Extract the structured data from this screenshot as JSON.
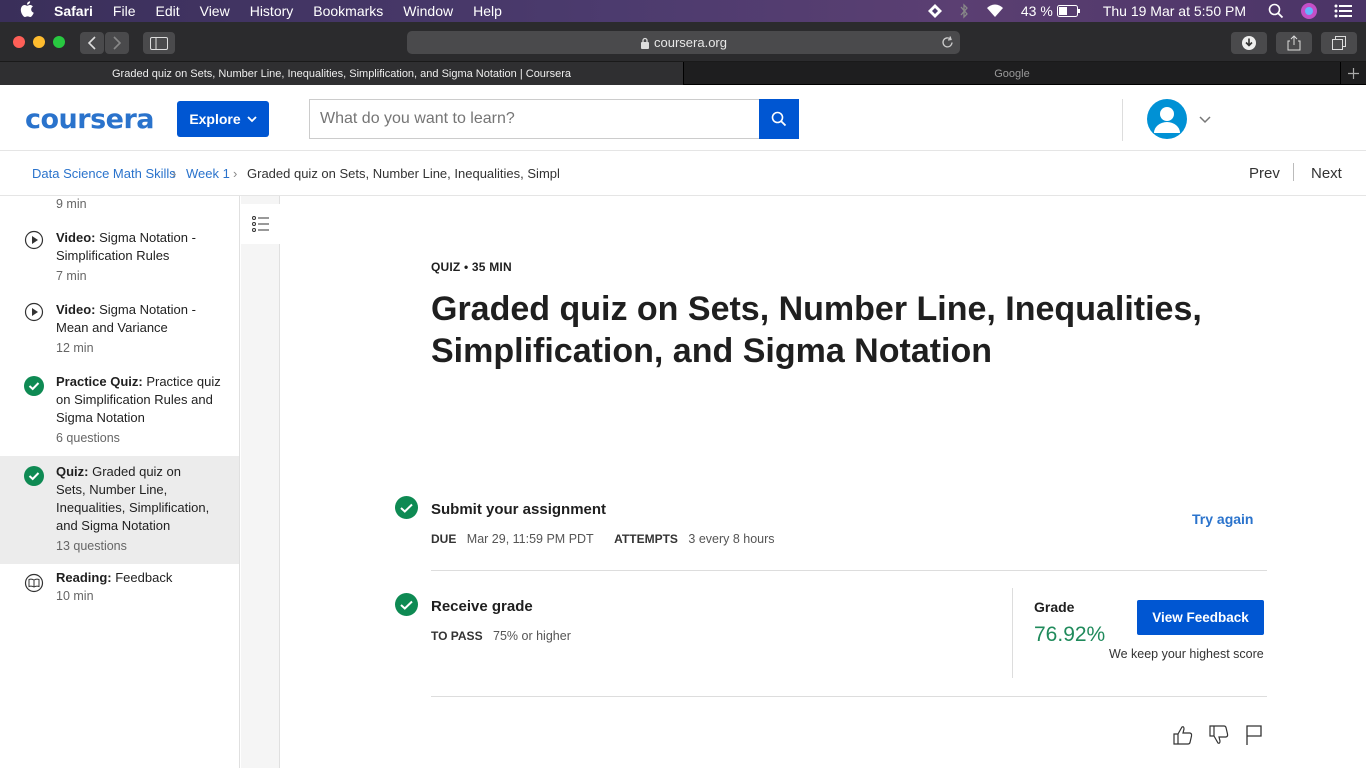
{
  "menubar": {
    "app": "Safari",
    "items": [
      "File",
      "Edit",
      "View",
      "History",
      "Bookmarks",
      "Window",
      "Help"
    ],
    "battery": "43 %",
    "datetime": "Thu 19 Mar at  5:50 PM"
  },
  "browser": {
    "url": "coursera.org",
    "tabs": [
      {
        "label": "Graded quiz on Sets, Number Line, Inequalities, Simplification, and Sigma Notation | Coursera",
        "active": true
      },
      {
        "label": "Google",
        "active": false
      }
    ]
  },
  "header": {
    "logo": "coursera",
    "explore_label": "Explore",
    "search_placeholder": "What do you want to learn?"
  },
  "breadcrumb": {
    "items": [
      "Data Science Math Skills",
      "Week 1",
      "Graded quiz on Sets, Number Line, Inequalities, Simpl"
    ],
    "prev": "Prev",
    "next": "Next"
  },
  "sidebar": {
    "items": [
      {
        "type": "",
        "title": "",
        "meta": "9 min",
        "icon": "none"
      },
      {
        "type": "Video:",
        "title": " Sigma Notation - Simplification Rules",
        "meta": "7 min",
        "icon": "play-icon"
      },
      {
        "type": "Video:",
        "title": " Sigma Notation - Mean and Variance",
        "meta": "12 min",
        "icon": "play-icon"
      },
      {
        "type": "Practice Quiz:",
        "title": " Practice quiz on Simplification Rules and Sigma Notation",
        "meta": "6 questions",
        "icon": "check-icon"
      },
      {
        "type": "Quiz:",
        "title": " Graded quiz on Sets, Number Line, Inequalities, Simplification, and Sigma Notation",
        "meta": "13 questions",
        "icon": "check-icon",
        "active": true
      },
      {
        "type": "Reading:",
        "title": " Feedback",
        "meta": "10 min",
        "icon": "book-icon"
      }
    ]
  },
  "quiz": {
    "label": "QUIZ • 35 MIN",
    "title": "Graded quiz on Sets, Number Line, Inequalities, Simplification, and Sigma Notation",
    "submit": {
      "title": "Submit your assignment",
      "due_label": "DUE",
      "due_value": "Mar 29, 11:59 PM PDT",
      "attempts_label": "ATTEMPTS",
      "attempts_value": "3 every 8 hours",
      "action": "Try again"
    },
    "receive": {
      "title": "Receive grade",
      "pass_label": "TO PASS",
      "pass_value": "75% or higher",
      "grade_label": "Grade",
      "grade_value": "76.92%",
      "feedback_button": "View Feedback",
      "note": "We keep your highest score"
    }
  },
  "colors": {
    "brand": "#0056d2",
    "link": "#2a73cc",
    "success": "#0e8a53"
  }
}
